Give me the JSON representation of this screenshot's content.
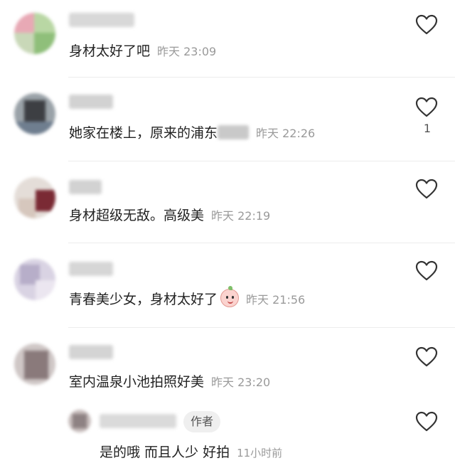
{
  "comments": [
    {
      "text": "身材太好了吧",
      "time": "昨天 23:09",
      "likes": ""
    },
    {
      "text": "她家在楼上，原来的浦东",
      "time": "昨天 22:26",
      "likes": "1"
    },
    {
      "text": "身材超级无敌。高级美",
      "time": "昨天 22:19",
      "likes": ""
    },
    {
      "text": "青春美少女，身材太好了",
      "time": "昨天 21:56",
      "likes": "",
      "emoji": "peach-face-emoji"
    },
    {
      "text": "室内温泉小池拍照好美",
      "time": "昨天 23:20",
      "likes": ""
    }
  ],
  "reply": {
    "author_tag": "作者",
    "text": "是的哦 而且人少 好拍",
    "time": "11小时前"
  },
  "icons": {
    "like": "heart-outline-icon"
  },
  "colors": {
    "time": "#9a9a9a",
    "divider": "#ececec",
    "tag_bg": "#efefef"
  }
}
